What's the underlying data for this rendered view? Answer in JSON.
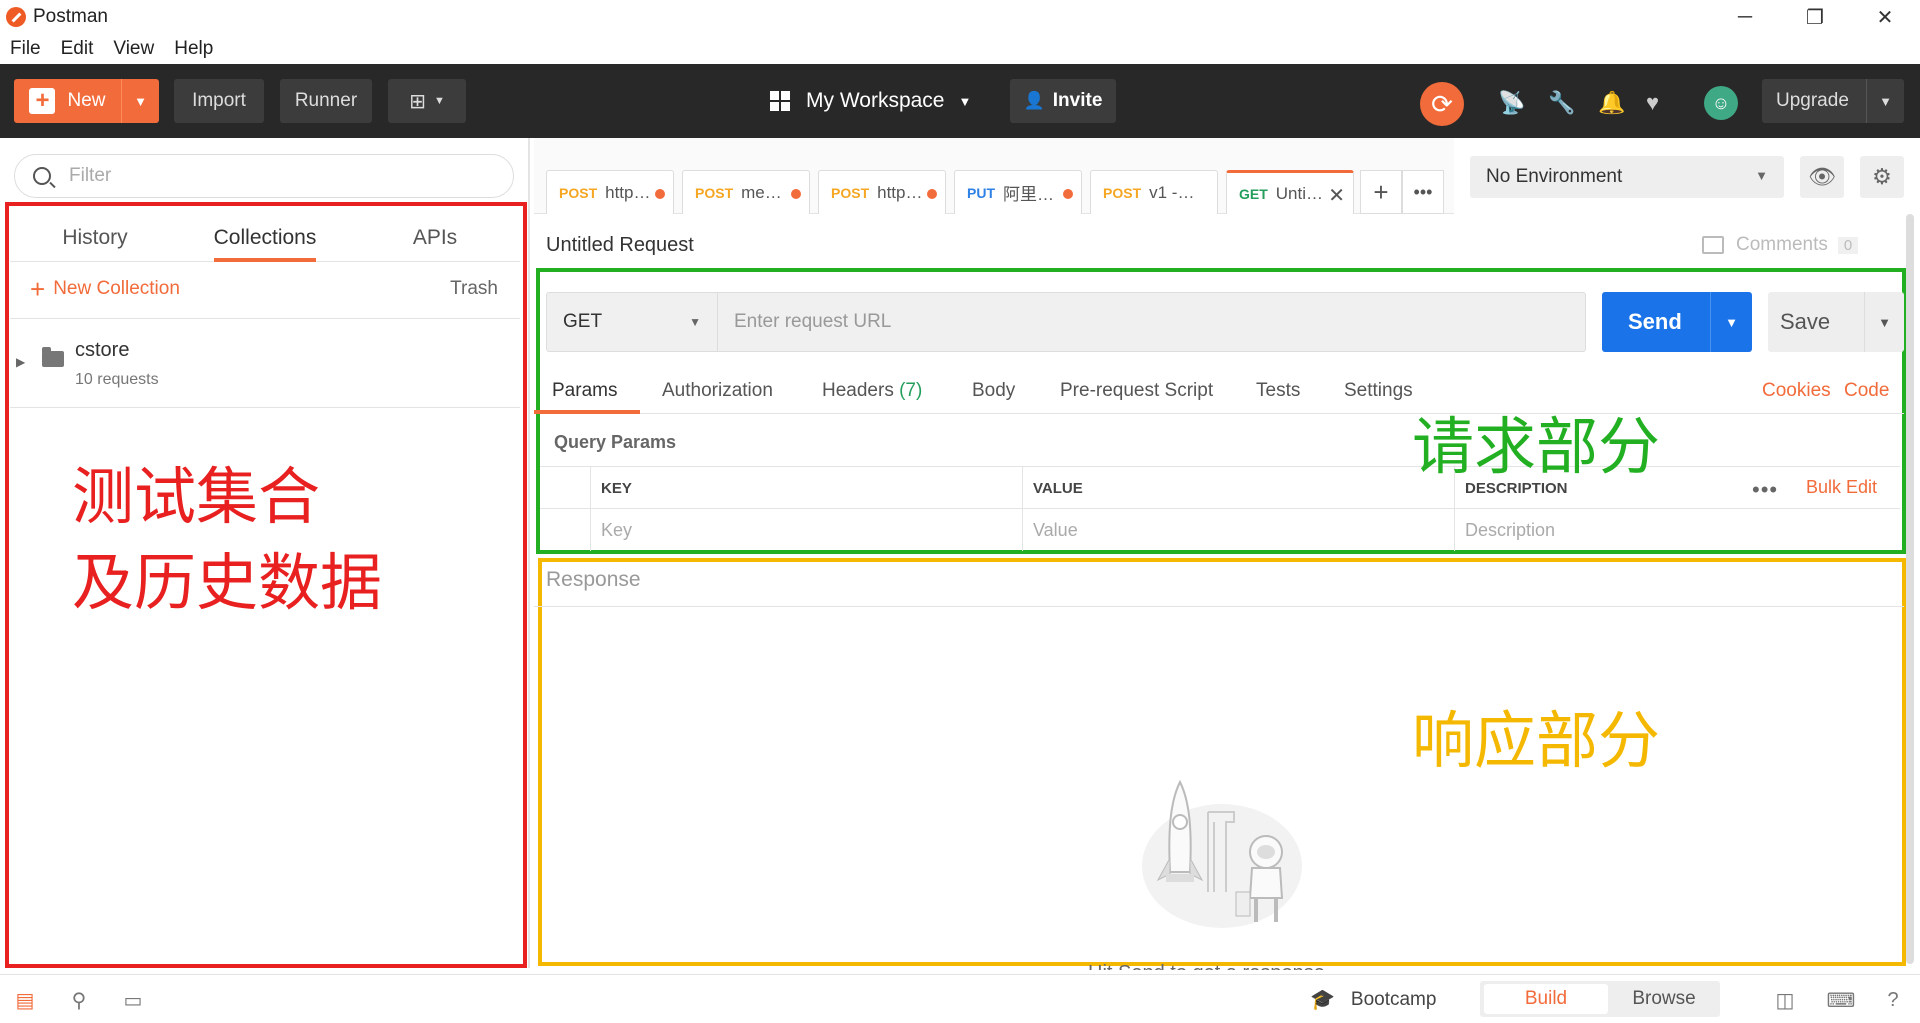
{
  "window": {
    "title": "Postman",
    "minimize": "─",
    "restore": "❐",
    "close": "✕"
  },
  "menu": [
    "File",
    "Edit",
    "View",
    "Help"
  ],
  "header": {
    "new_label": "New",
    "import_label": "Import",
    "runner_label": "Runner",
    "workspace_label": "My Workspace",
    "invite_label": "Invite",
    "upgrade_label": "Upgrade",
    "icons": [
      "sync-icon",
      "satellite-icon",
      "wrench-icon",
      "bell-icon",
      "heart-icon",
      "avatar"
    ]
  },
  "sidebar": {
    "filter_placeholder": "Filter",
    "tabs": [
      "History",
      "Collections",
      "APIs"
    ],
    "active_tab": "Collections",
    "new_collection_label": "New Collection",
    "trash_label": "Trash",
    "collections": [
      {
        "name": "cstore",
        "count": "10 requests"
      }
    ]
  },
  "annotations": {
    "sidebar_line1": "测试集合",
    "sidebar_line2": "及历史数据",
    "request": "请求部分",
    "response": "响应部分"
  },
  "request_tabs": [
    {
      "method": "POST",
      "name": "http…"
    },
    {
      "method": "POST",
      "name": "me…"
    },
    {
      "method": "POST",
      "name": "http…"
    },
    {
      "method": "PUT",
      "name": "阿里…"
    },
    {
      "method": "POST",
      "name": "v1 -…"
    },
    {
      "method": "GET",
      "name": "Unti…"
    }
  ],
  "environment": {
    "selected": "No Environment"
  },
  "request": {
    "name": "Untitled Request",
    "comments_label": "Comments",
    "comments_count": "0",
    "method": "GET",
    "url_placeholder": "Enter request URL",
    "send_label": "Send",
    "save_label": "Save",
    "subtabs": [
      "Params",
      "Authorization",
      "Headers",
      "Body",
      "Pre-request Script",
      "Tests",
      "Settings"
    ],
    "headers_count": "(7)",
    "cookies_label": "Cookies",
    "code_label": "Code",
    "query_params_label": "Query Params",
    "columns": [
      "KEY",
      "VALUE",
      "DESCRIPTION"
    ],
    "placeholders": [
      "Key",
      "Value",
      "Description"
    ],
    "bulk_edit_label": "Bulk Edit"
  },
  "response": {
    "label": "Response",
    "hint": "Hit Send to get a response"
  },
  "statusbar": {
    "bootcamp_label": "Bootcamp",
    "build_label": "Build",
    "browse_label": "Browse"
  },
  "colors": {
    "accent": "#f26b3a",
    "send": "#1a73e8",
    "post": "#f5a623",
    "put": "#2f82e5",
    "get": "#249e5c",
    "annotation_red": "#e82020",
    "annotation_green": "#22b022",
    "annotation_yellow": "#f5b800"
  }
}
